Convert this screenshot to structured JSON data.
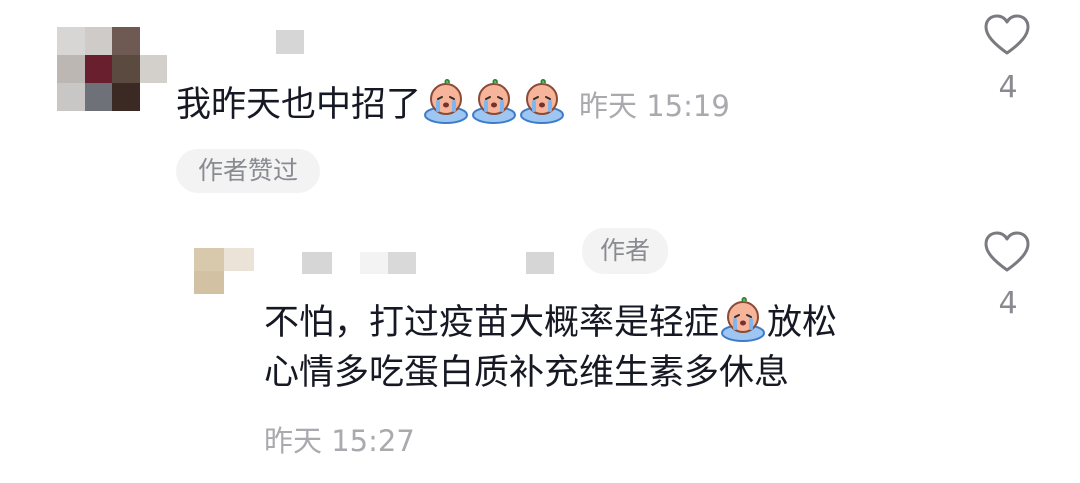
{
  "comment": {
    "text": "我昨天也中招了",
    "time": "昨天 15:19",
    "likes": "4",
    "author_liked_label": "作者赞过"
  },
  "reply": {
    "author_badge": "作者",
    "text_line1": "不怕，打过疫苗大概率是轻症",
    "text_line1_tail": "放松",
    "text_line2": "心情多吃蛋白质补充维生素多休息",
    "time": "昨天 15:27",
    "likes": "4"
  },
  "icons": {
    "like": "heart-outline-icon",
    "emoji": "crying-peach-emoji-icon"
  },
  "colors": {
    "text": "#161823",
    "secondary": "#8a8b91",
    "chip_bg": "#f3f3f4"
  }
}
